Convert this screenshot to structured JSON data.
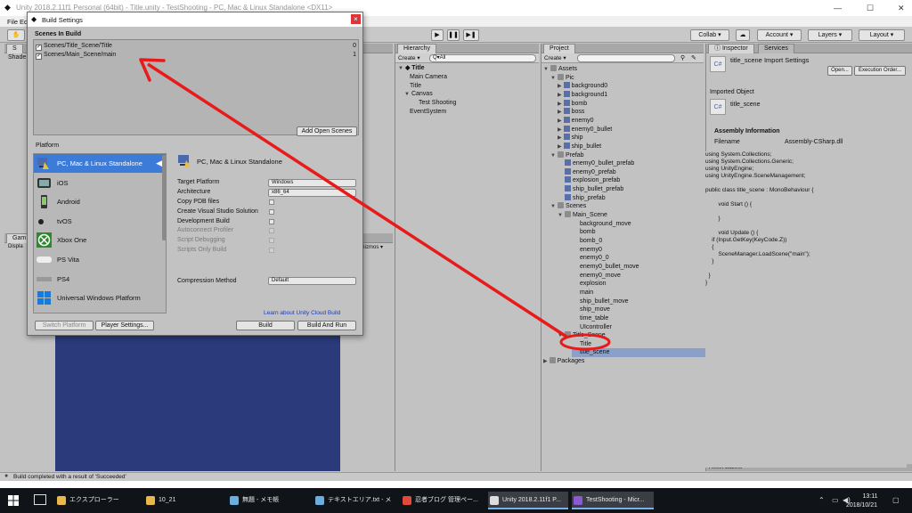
{
  "window": {
    "title": "Unity 2018.2.11f1 Personal (64bit) - Title.unity - TestShooting - PC, Mac & Linux Standalone <DX11>",
    "menu": [
      "File",
      "Ed"
    ]
  },
  "toolbar": {
    "collab": "Collab ▾",
    "account": "Account ▾",
    "layers": "Layers ▾",
    "layout": "Layout ▾",
    "scene_tab_partial": "S",
    "shaded": "Shade"
  },
  "hierarchy": {
    "tab": "Hierarchy",
    "create": "Create ▾",
    "search_placeholder": "Q▾All",
    "scene": "Title",
    "items": [
      {
        "label": "Main Camera",
        "indent": 0
      },
      {
        "label": "Title",
        "indent": 0
      },
      {
        "label": "Canvas",
        "indent": 0
      },
      {
        "label": "Test Shooting",
        "indent": 1
      },
      {
        "label": "EventSystem",
        "indent": 0
      }
    ]
  },
  "project": {
    "tab": "Project",
    "create": "Create ▾",
    "assets_label": "Assets",
    "pic_label": "Pic",
    "pic_items": [
      "background0",
      "background1",
      "bomb",
      "boss",
      "enemy0",
      "enemy0_bullet",
      "ship",
      "ship_bullet"
    ],
    "prefab_label": "Prefab",
    "prefab_items": [
      "enemy0_bullet_prefab",
      "enemy0_prefab",
      "explosion_prefab",
      "ship_bullet_prefab",
      "ship_prefab"
    ],
    "scenes_label": "Scenes",
    "main_scene_label": "Main_Scene",
    "main_scene_items": [
      "background_move",
      "bomb",
      "bomb_0",
      "enemy0",
      "enemy0_0",
      "enemy0_bullet_move",
      "enemy0_move",
      "explosion",
      "main",
      "ship_bullet_move",
      "ship_move",
      "time_table",
      "UIcontroller"
    ],
    "title_scene_label": "Title_Scene",
    "title_scene_items": [
      "Title",
      "title_scene"
    ],
    "packages_label": "Packages"
  },
  "inspector": {
    "tab_inspector": "Inspector",
    "tab_services": "Services",
    "header": "title_scene Import Settings",
    "open": "Open...",
    "execution_order": "Execution Order...",
    "imported_object": "Imported Object",
    "object_name": "title_scene",
    "assembly_info": "Assembly Information",
    "filename_label": "Filename",
    "filename_value": "Assembly-CSharp.dll",
    "code": "using System.Collections;\nusing System.Collections.Generic;\nusing UnityEngine;\nusing UnityEngine.SceneManagement;\n\npublic class title_scene : MonoBehaviour {\n\n        void Start () {\n\n        }\n\n        void Update () {\n    if (Input.GetKey(KeyCode.Z))\n    {\n        SceneManager.LoadScene(\"main\");\n    }\n\n  }\n}",
    "asset_labels": "Asset Labels"
  },
  "game": {
    "tab": "Gam",
    "display": "Displa",
    "gizmos": "Gizmos ▾"
  },
  "build_settings": {
    "title": "Build Settings",
    "close": "×",
    "scenes_in_build": "Scenes In Build",
    "scenes": [
      {
        "path": "Scenes/Title_Scene/Title",
        "index": "0",
        "checked": true
      },
      {
        "path": "Scenes/Main_Scene/main",
        "index": "1",
        "checked": true
      }
    ],
    "add_open_scenes": "Add Open Scenes",
    "platform_label": "Platform",
    "platforms": [
      {
        "name": "PC, Mac & Linux Standalone",
        "icon": "pc-icon",
        "selected": true
      },
      {
        "name": "iOS",
        "icon": "ios-icon"
      },
      {
        "name": "Android",
        "icon": "android-icon"
      },
      {
        "name": "tvOS",
        "icon": "tvos-icon"
      },
      {
        "name": "Xbox One",
        "icon": "xbox-icon"
      },
      {
        "name": "PS Vita",
        "icon": "psvita-icon"
      },
      {
        "name": "PS4",
        "icon": "ps4-icon"
      },
      {
        "name": "Universal Windows Platform",
        "icon": "windows-icon"
      }
    ],
    "selected_platform_title": "PC, Mac & Linux Standalone",
    "target_platform_label": "Target Platform",
    "target_platform_value": "Windows",
    "architecture_label": "Architecture",
    "architecture_value": "x86_64",
    "options": [
      {
        "label": "Copy PDB files",
        "disabled": false
      },
      {
        "label": "Create Visual Studio Solution",
        "disabled": false
      },
      {
        "label": "Development Build",
        "disabled": false
      },
      {
        "label": "Autoconnect Profiler",
        "disabled": true
      },
      {
        "label": "Script Debugging",
        "disabled": true
      },
      {
        "label": "Scripts Only Build",
        "disabled": true
      }
    ],
    "compression_label": "Compression Method",
    "compression_value": "Default",
    "cloud_link": "Learn about Unity Cloud Build",
    "switch_platform": "Switch Platform",
    "player_settings": "Player Settings...",
    "build": "Build",
    "build_and_run": "Build And Run"
  },
  "status": "Build completed with a result of 'Succeeded'",
  "taskbar": {
    "items": [
      {
        "label": "エクスプローラー",
        "color": "#e8b84a"
      },
      {
        "label": "10_21",
        "color": "#e8b84a"
      },
      {
        "label": "無題 - メモ帳",
        "color": "#6aaee0"
      },
      {
        "label": "テキストエリア.txt - メ",
        "color": "#6aaee0"
      },
      {
        "label": "忍者ブログ 管理ペー...",
        "color": "#e04a3a"
      },
      {
        "label": "Unity 2018.2.11f1 P...",
        "color": "#dddddd"
      },
      {
        "label": "TestShooting - Micr...",
        "color": "#8c5ad0"
      }
    ],
    "time": "13:11",
    "date": "2018/10/21"
  },
  "colors": {
    "annotation": "#e81a1a",
    "selection": "#3d7bd8"
  }
}
